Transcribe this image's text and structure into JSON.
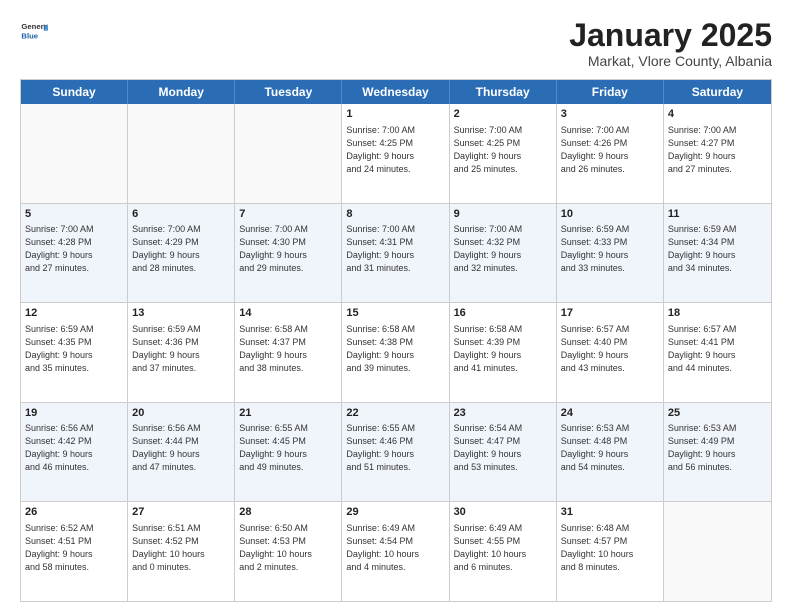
{
  "header": {
    "logo_general": "General",
    "logo_blue": "Blue",
    "month_title": "January 2025",
    "subtitle": "Markat, Vlore County, Albania"
  },
  "day_headers": [
    "Sunday",
    "Monday",
    "Tuesday",
    "Wednesday",
    "Thursday",
    "Friday",
    "Saturday"
  ],
  "weeks": [
    {
      "alt": false,
      "days": [
        {
          "number": "",
          "info": ""
        },
        {
          "number": "",
          "info": ""
        },
        {
          "number": "",
          "info": ""
        },
        {
          "number": "1",
          "info": "Sunrise: 7:00 AM\nSunset: 4:25 PM\nDaylight: 9 hours\nand 24 minutes."
        },
        {
          "number": "2",
          "info": "Sunrise: 7:00 AM\nSunset: 4:25 PM\nDaylight: 9 hours\nand 25 minutes."
        },
        {
          "number": "3",
          "info": "Sunrise: 7:00 AM\nSunset: 4:26 PM\nDaylight: 9 hours\nand 26 minutes."
        },
        {
          "number": "4",
          "info": "Sunrise: 7:00 AM\nSunset: 4:27 PM\nDaylight: 9 hours\nand 27 minutes."
        }
      ]
    },
    {
      "alt": true,
      "days": [
        {
          "number": "5",
          "info": "Sunrise: 7:00 AM\nSunset: 4:28 PM\nDaylight: 9 hours\nand 27 minutes."
        },
        {
          "number": "6",
          "info": "Sunrise: 7:00 AM\nSunset: 4:29 PM\nDaylight: 9 hours\nand 28 minutes."
        },
        {
          "number": "7",
          "info": "Sunrise: 7:00 AM\nSunset: 4:30 PM\nDaylight: 9 hours\nand 29 minutes."
        },
        {
          "number": "8",
          "info": "Sunrise: 7:00 AM\nSunset: 4:31 PM\nDaylight: 9 hours\nand 31 minutes."
        },
        {
          "number": "9",
          "info": "Sunrise: 7:00 AM\nSunset: 4:32 PM\nDaylight: 9 hours\nand 32 minutes."
        },
        {
          "number": "10",
          "info": "Sunrise: 6:59 AM\nSunset: 4:33 PM\nDaylight: 9 hours\nand 33 minutes."
        },
        {
          "number": "11",
          "info": "Sunrise: 6:59 AM\nSunset: 4:34 PM\nDaylight: 9 hours\nand 34 minutes."
        }
      ]
    },
    {
      "alt": false,
      "days": [
        {
          "number": "12",
          "info": "Sunrise: 6:59 AM\nSunset: 4:35 PM\nDaylight: 9 hours\nand 35 minutes."
        },
        {
          "number": "13",
          "info": "Sunrise: 6:59 AM\nSunset: 4:36 PM\nDaylight: 9 hours\nand 37 minutes."
        },
        {
          "number": "14",
          "info": "Sunrise: 6:58 AM\nSunset: 4:37 PM\nDaylight: 9 hours\nand 38 minutes."
        },
        {
          "number": "15",
          "info": "Sunrise: 6:58 AM\nSunset: 4:38 PM\nDaylight: 9 hours\nand 39 minutes."
        },
        {
          "number": "16",
          "info": "Sunrise: 6:58 AM\nSunset: 4:39 PM\nDaylight: 9 hours\nand 41 minutes."
        },
        {
          "number": "17",
          "info": "Sunrise: 6:57 AM\nSunset: 4:40 PM\nDaylight: 9 hours\nand 43 minutes."
        },
        {
          "number": "18",
          "info": "Sunrise: 6:57 AM\nSunset: 4:41 PM\nDaylight: 9 hours\nand 44 minutes."
        }
      ]
    },
    {
      "alt": true,
      "days": [
        {
          "number": "19",
          "info": "Sunrise: 6:56 AM\nSunset: 4:42 PM\nDaylight: 9 hours\nand 46 minutes."
        },
        {
          "number": "20",
          "info": "Sunrise: 6:56 AM\nSunset: 4:44 PM\nDaylight: 9 hours\nand 47 minutes."
        },
        {
          "number": "21",
          "info": "Sunrise: 6:55 AM\nSunset: 4:45 PM\nDaylight: 9 hours\nand 49 minutes."
        },
        {
          "number": "22",
          "info": "Sunrise: 6:55 AM\nSunset: 4:46 PM\nDaylight: 9 hours\nand 51 minutes."
        },
        {
          "number": "23",
          "info": "Sunrise: 6:54 AM\nSunset: 4:47 PM\nDaylight: 9 hours\nand 53 minutes."
        },
        {
          "number": "24",
          "info": "Sunrise: 6:53 AM\nSunset: 4:48 PM\nDaylight: 9 hours\nand 54 minutes."
        },
        {
          "number": "25",
          "info": "Sunrise: 6:53 AM\nSunset: 4:49 PM\nDaylight: 9 hours\nand 56 minutes."
        }
      ]
    },
    {
      "alt": false,
      "days": [
        {
          "number": "26",
          "info": "Sunrise: 6:52 AM\nSunset: 4:51 PM\nDaylight: 9 hours\nand 58 minutes."
        },
        {
          "number": "27",
          "info": "Sunrise: 6:51 AM\nSunset: 4:52 PM\nDaylight: 10 hours\nand 0 minutes."
        },
        {
          "number": "28",
          "info": "Sunrise: 6:50 AM\nSunset: 4:53 PM\nDaylight: 10 hours\nand 2 minutes."
        },
        {
          "number": "29",
          "info": "Sunrise: 6:49 AM\nSunset: 4:54 PM\nDaylight: 10 hours\nand 4 minutes."
        },
        {
          "number": "30",
          "info": "Sunrise: 6:49 AM\nSunset: 4:55 PM\nDaylight: 10 hours\nand 6 minutes."
        },
        {
          "number": "31",
          "info": "Sunrise: 6:48 AM\nSunset: 4:57 PM\nDaylight: 10 hours\nand 8 minutes."
        },
        {
          "number": "",
          "info": ""
        }
      ]
    }
  ]
}
